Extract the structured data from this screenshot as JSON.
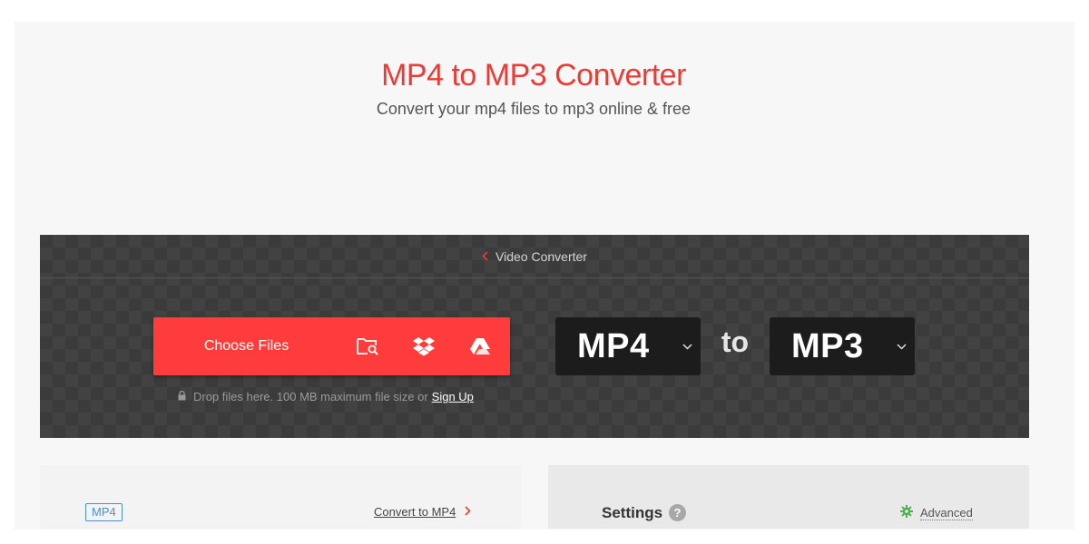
{
  "hero": {
    "title": "MP4 to MP3 Converter",
    "subtitle": "Convert your mp4 files to mp3 online & free"
  },
  "converter": {
    "breadcrumb_label": "Video Converter",
    "choose_files_label": "Choose Files",
    "sources": [
      "folder-search-icon",
      "dropbox-icon",
      "google-drive-icon"
    ],
    "drop_hint": "Drop files here. 100 MB maximum file size or",
    "signup_label": "Sign Up",
    "from_format": "MP4",
    "to_word": "to",
    "to_format": "MP3"
  },
  "info_panel": {
    "format_badge": "MP4",
    "convert_link": "Convert to MP4"
  },
  "settings_panel": {
    "title": "Settings",
    "help_symbol": "?",
    "advanced_label": "Advanced"
  },
  "colors": {
    "brand_red": "#ee3a34",
    "button_red": "#ff3c3c",
    "badge_blue": "#4a90d9",
    "gear_green": "#4caf50"
  }
}
